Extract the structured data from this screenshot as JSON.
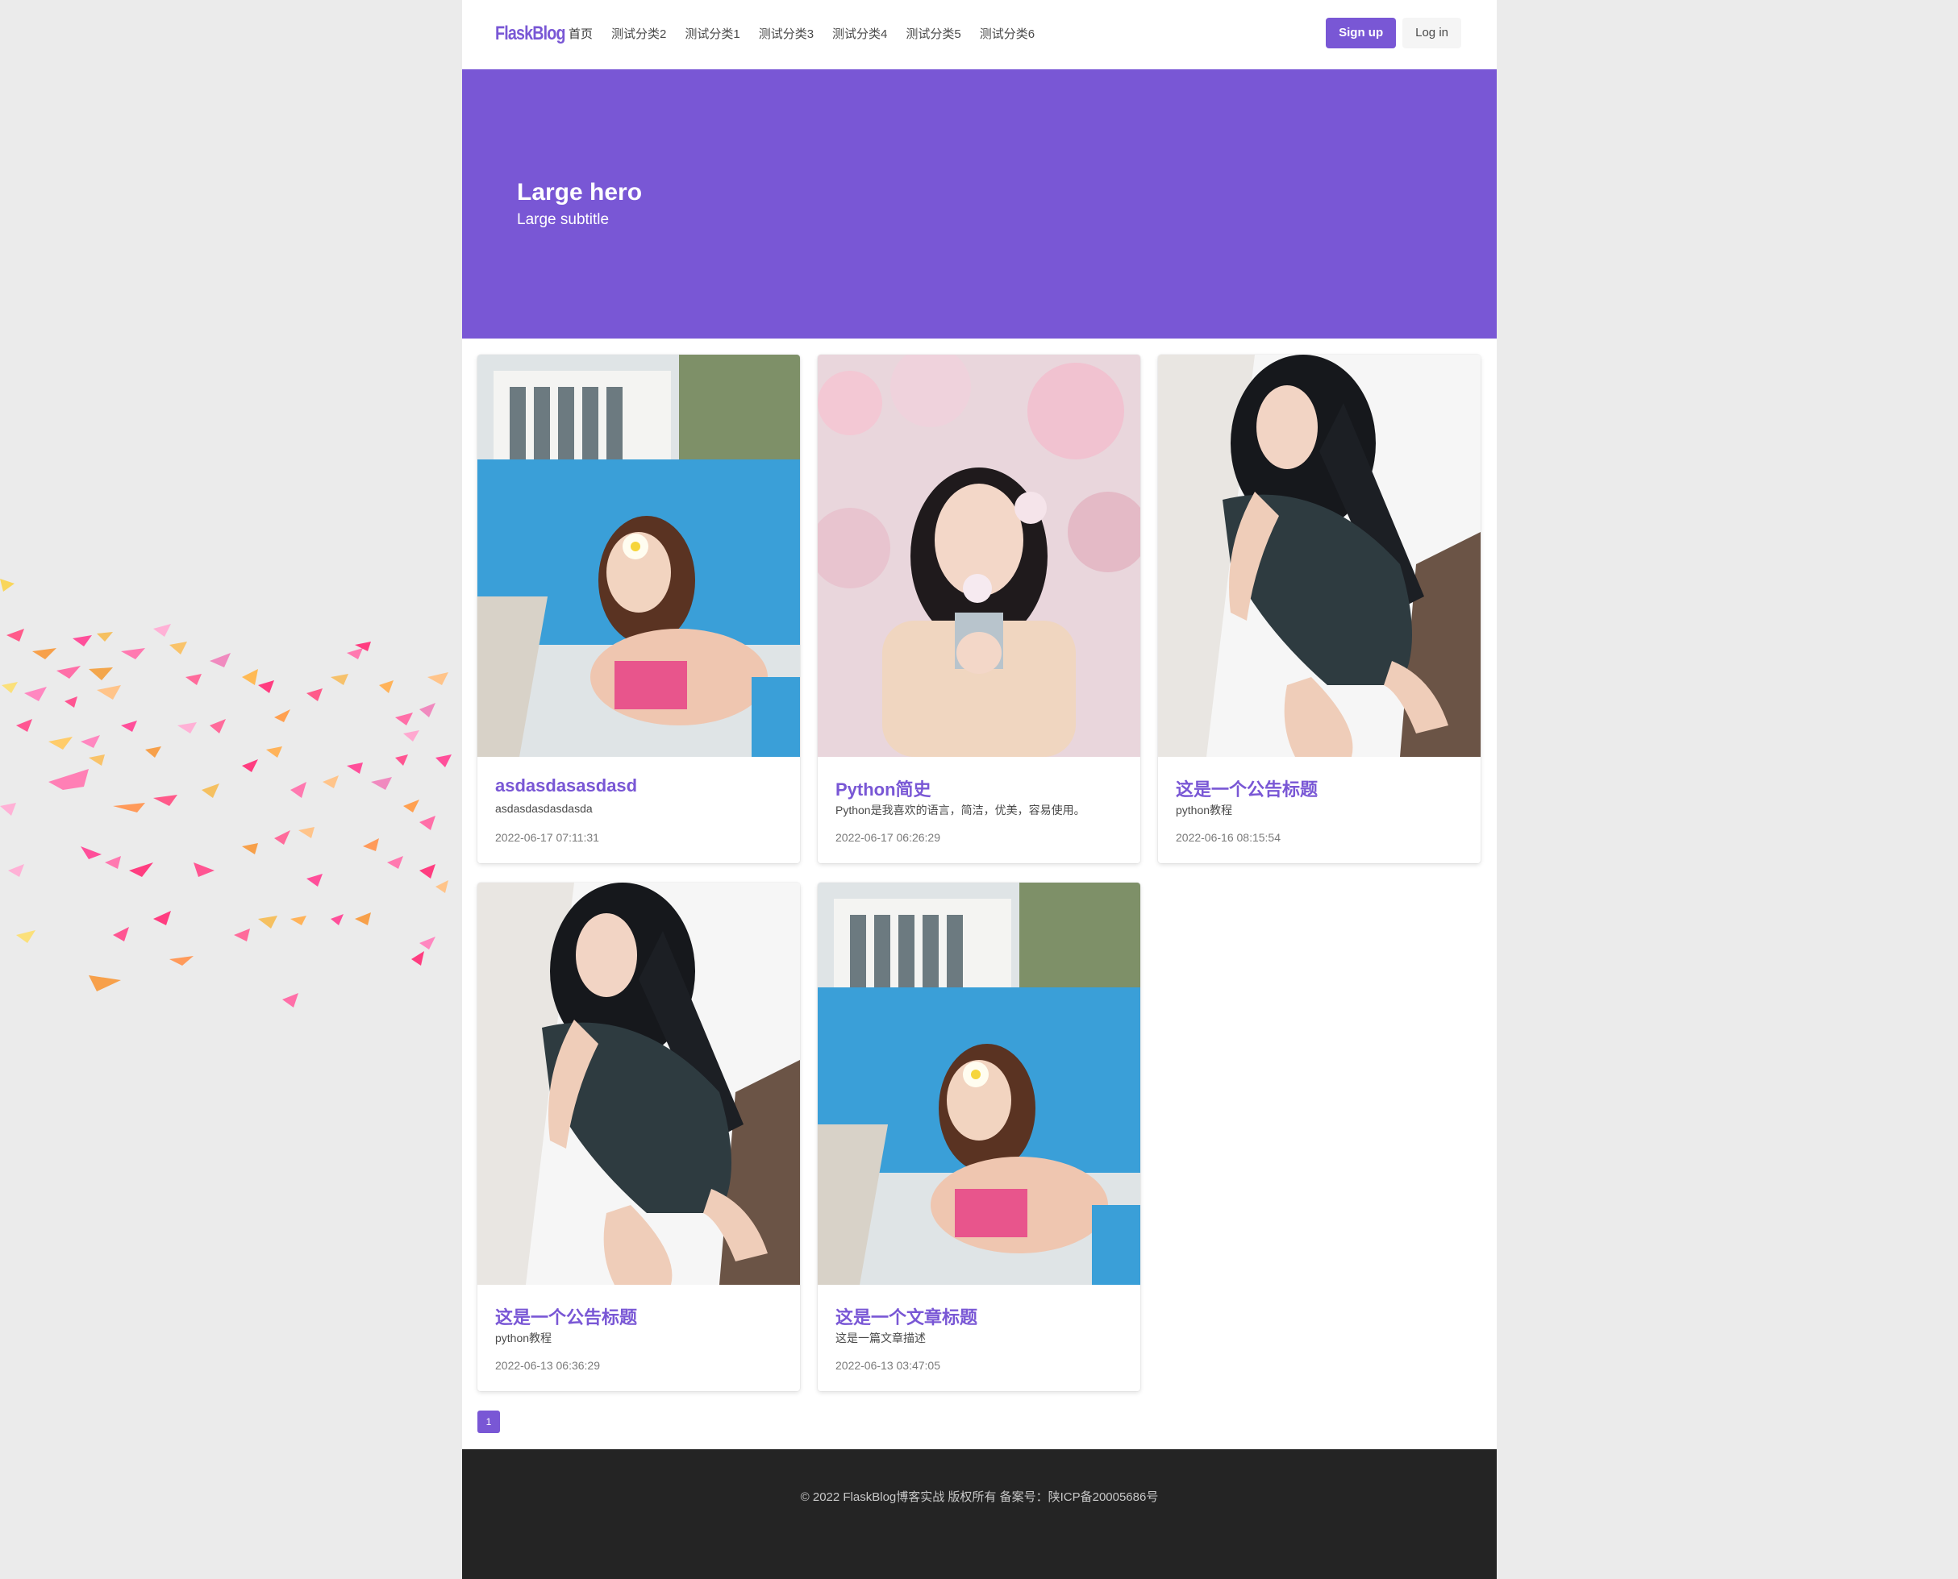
{
  "navbar": {
    "brand": "FlaskBlog",
    "items": [
      {
        "label": "首页",
        "active": true
      },
      {
        "label": "测试分类2"
      },
      {
        "label": "测试分类1"
      },
      {
        "label": "测试分类3"
      },
      {
        "label": "测试分类4"
      },
      {
        "label": "测试分类5"
      },
      {
        "label": "测试分类6"
      }
    ],
    "signup_label": "Sign up",
    "login_label": "Log in"
  },
  "hero": {
    "title": "Large hero",
    "subtitle": "Large subtitle"
  },
  "posts": [
    {
      "title": "asdasdasasdasd",
      "description": "asdasdasdasdasda",
      "date": "2022-06-17 07:11:31",
      "image": "photo-pool-flower-girl"
    },
    {
      "title": "Python简史",
      "description": "Python是我喜欢的语言，简洁，优美，容易使用。",
      "date": "2022-06-17 06:26:29",
      "image": "photo-cherry-blossom-girl"
    },
    {
      "title": "这是一个公告标题",
      "description": "python教程",
      "date": "2022-06-16 08:15:54",
      "image": "photo-swimsuit-girl"
    },
    {
      "title": "这是一个公告标题",
      "description": "python教程",
      "date": "2022-06-13 06:36:29",
      "image": "photo-swimsuit-girl"
    },
    {
      "title": "这是一个文章标题",
      "description": "这是一篇文章描述",
      "date": "2022-06-13 03:47:05",
      "image": "photo-pool-flower-girl"
    }
  ],
  "pagination": {
    "current": "1"
  },
  "footer": {
    "text": "© 2022 FlaskBlog博客实战 版权所有 备案号：陕ICP备20005686号"
  },
  "colors": {
    "primary": "#7957d5",
    "footer_bg": "#242424",
    "page_bg": "#ebebeb"
  }
}
